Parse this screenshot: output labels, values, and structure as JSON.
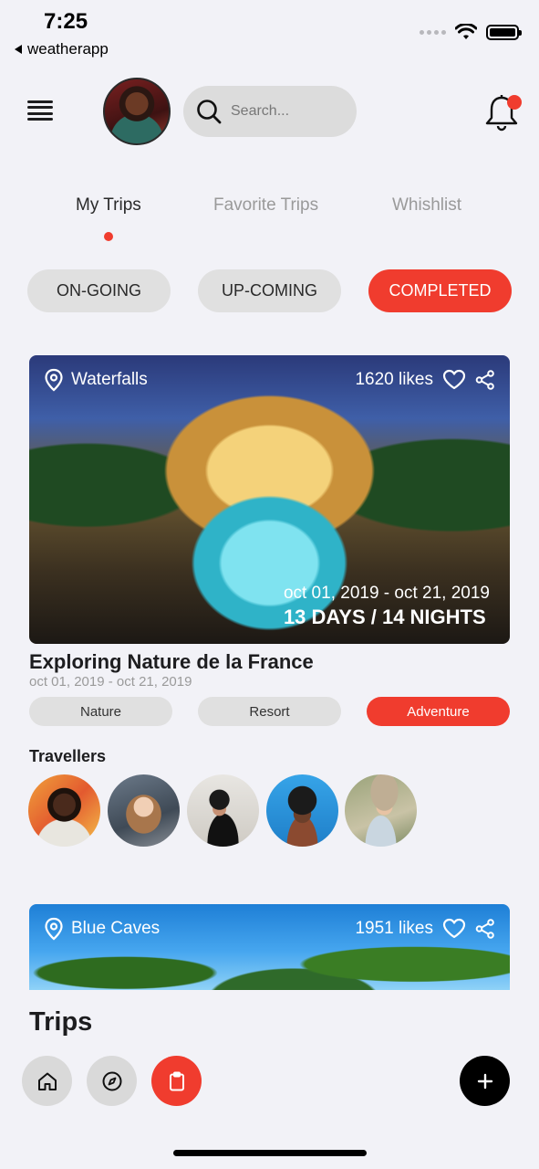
{
  "status_bar": {
    "time": "7:25",
    "back_app": "weatherapp"
  },
  "header": {
    "search_placeholder": "Search...",
    "has_notification": true
  },
  "tabs": [
    {
      "label": "My Trips",
      "active": true
    },
    {
      "label": "Favorite Trips",
      "active": false
    },
    {
      "label": "Whishlist",
      "active": false
    }
  ],
  "filters": [
    {
      "label": "ON-GOING",
      "active": false
    },
    {
      "label": "UP-COMING",
      "active": false
    },
    {
      "label": "COMPLETED",
      "active": true
    }
  ],
  "trips": [
    {
      "location": "Waterfalls",
      "likes": "1620  likes",
      "date_range": "oct 01, 2019 - oct 21, 2019",
      "duration": "13 DAYS / 14 NIGHTS",
      "title": "Exploring Nature de la France",
      "subtitle_dates": "oct 01, 2019 - oct 21, 2019",
      "tags": [
        {
          "label": "Nature",
          "active": false
        },
        {
          "label": "Resort",
          "active": false
        },
        {
          "label": "Adventure",
          "active": true
        }
      ],
      "travellers_label": "Travellers"
    },
    {
      "location": "Blue Caves",
      "likes": "1951  likes"
    }
  ],
  "bottom": {
    "title": "Trips"
  },
  "colors": {
    "accent": "#f03c2e",
    "pill_bg": "#e0e0e0",
    "background": "#f2f2f7"
  },
  "icons": [
    "menu-icon",
    "search-icon",
    "bell-icon",
    "location-pin-icon",
    "heart-icon",
    "share-icon",
    "home-icon",
    "compass-icon",
    "clipboard-icon",
    "plus-icon"
  ]
}
